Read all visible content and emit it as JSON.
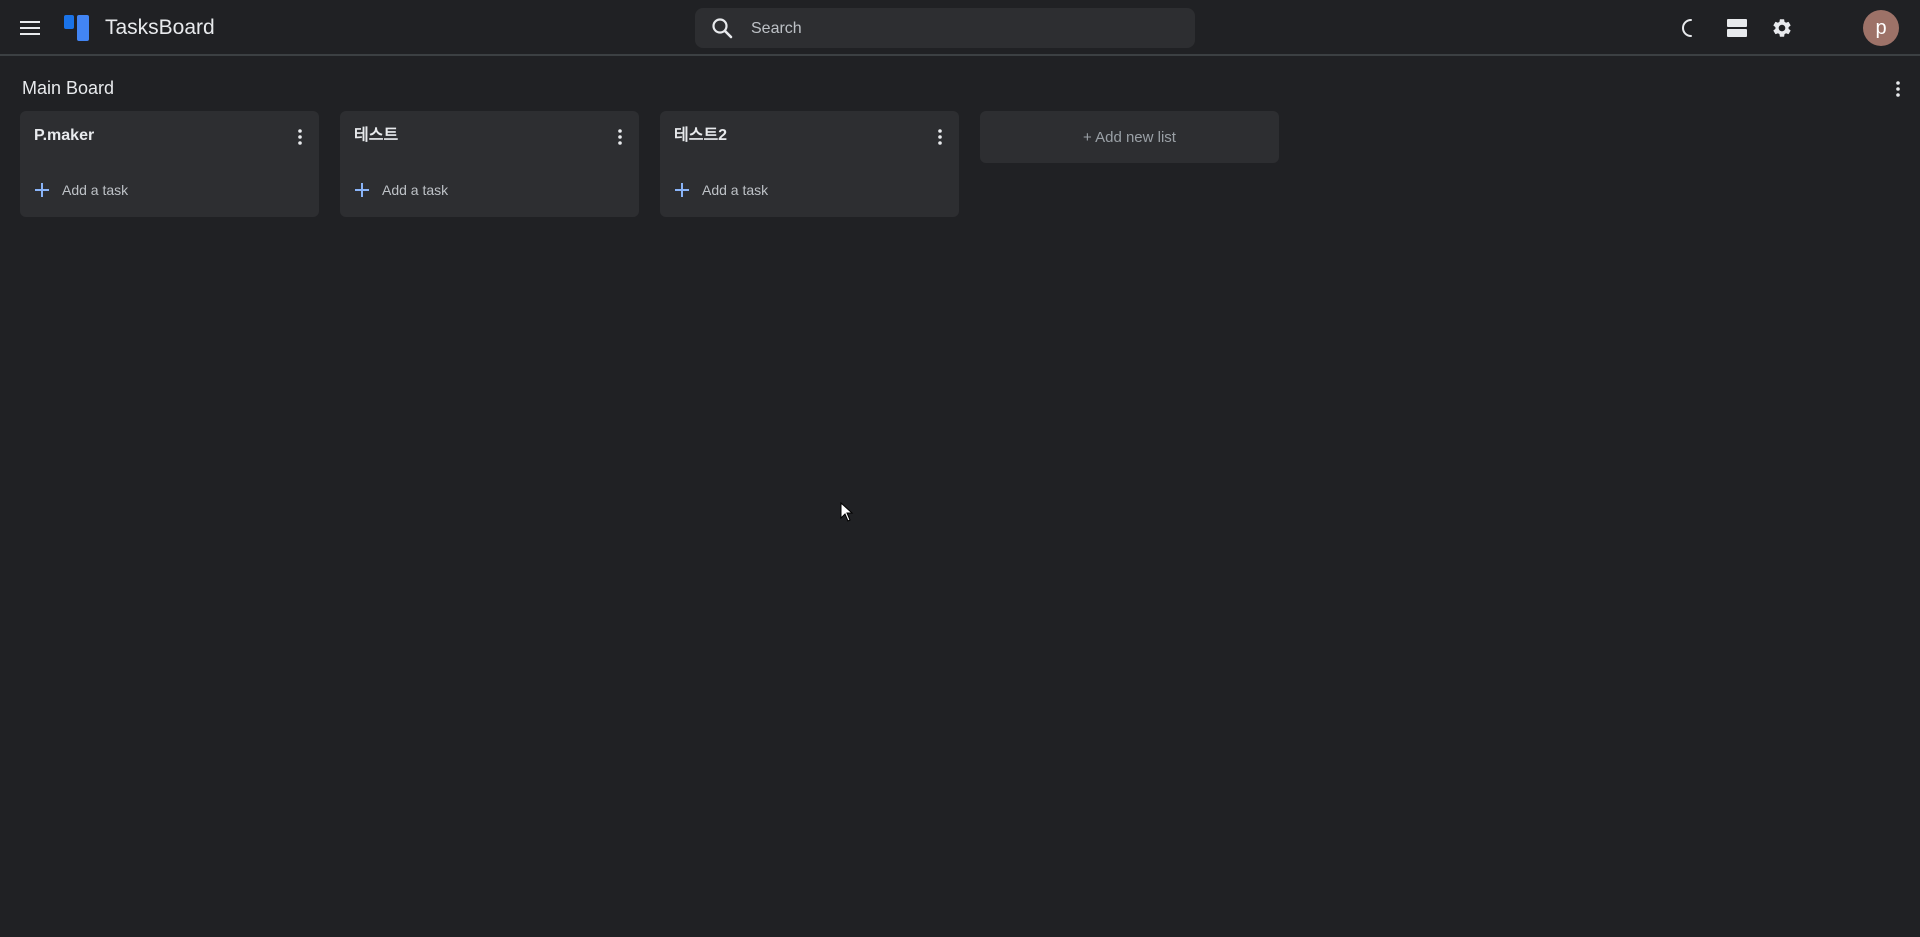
{
  "app": {
    "title": "TasksBoard",
    "brand_color": "#1a73e8"
  },
  "header": {
    "menu_icon": "hamburger-menu-icon",
    "search": {
      "placeholder": "Search",
      "value": ""
    },
    "icons": [
      "loading-spinner-icon",
      "view-toggle-icon",
      "gear-icon"
    ],
    "avatar_letter": "p",
    "avatar_color": "#9d7268"
  },
  "board": {
    "title": "Main Board",
    "lists": [
      {
        "title": "P.maker",
        "add_task_label": "Add a task"
      },
      {
        "title": "테스트",
        "add_task_label": "Add a task"
      },
      {
        "title": "테스트2",
        "add_task_label": "Add a task"
      }
    ],
    "add_list_label": "+ Add new list"
  }
}
